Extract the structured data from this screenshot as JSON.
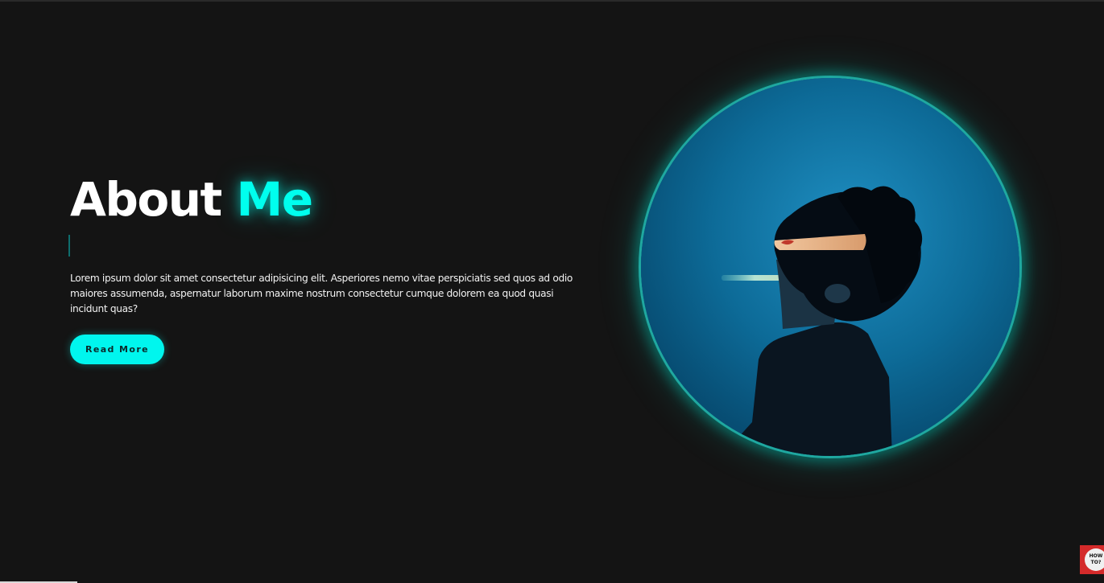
{
  "about": {
    "heading_main": "About",
    "heading_accent": "Me",
    "description": "Lorem ipsum dolor sit amet consectetur adipisicing elit. Asperiores nemo vitae perspiciatis sed quos ad odio maiores assumenda, aspernatur laborum maxime nostrum consectetur cumque dolorem ea quod quasi incidunt quas?",
    "button_label": "Read More"
  },
  "colors": {
    "background": "#141414",
    "accent": "#00ffee",
    "text": "#ffffff",
    "image_ring": "#1fa8a0"
  },
  "image": {
    "subject": "profile photo of a person looking upward against a blue background",
    "icon": "portrait-photo"
  },
  "corner_badge": {
    "line1": "HOW",
    "line2": "TO?"
  }
}
